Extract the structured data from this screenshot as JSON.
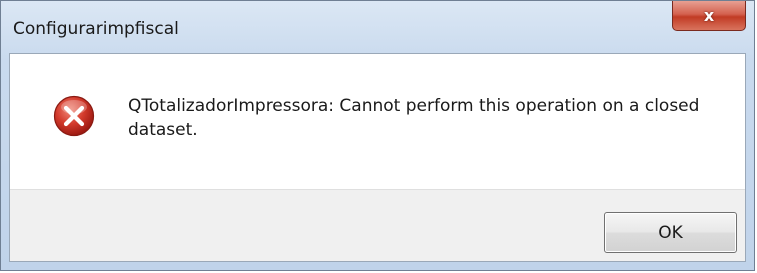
{
  "window": {
    "title": "Configurarimpfiscal"
  },
  "close_button": {
    "label": "x",
    "icon": "close-icon"
  },
  "dialog": {
    "icon": "error-icon",
    "message": "QTotalizadorImpressora: Cannot perform this operation on a closed dataset.",
    "ok_label": "OK"
  },
  "colors": {
    "error_red": "#c8322a",
    "title_bar": "#c9daee",
    "close_red": "#c13b24"
  }
}
